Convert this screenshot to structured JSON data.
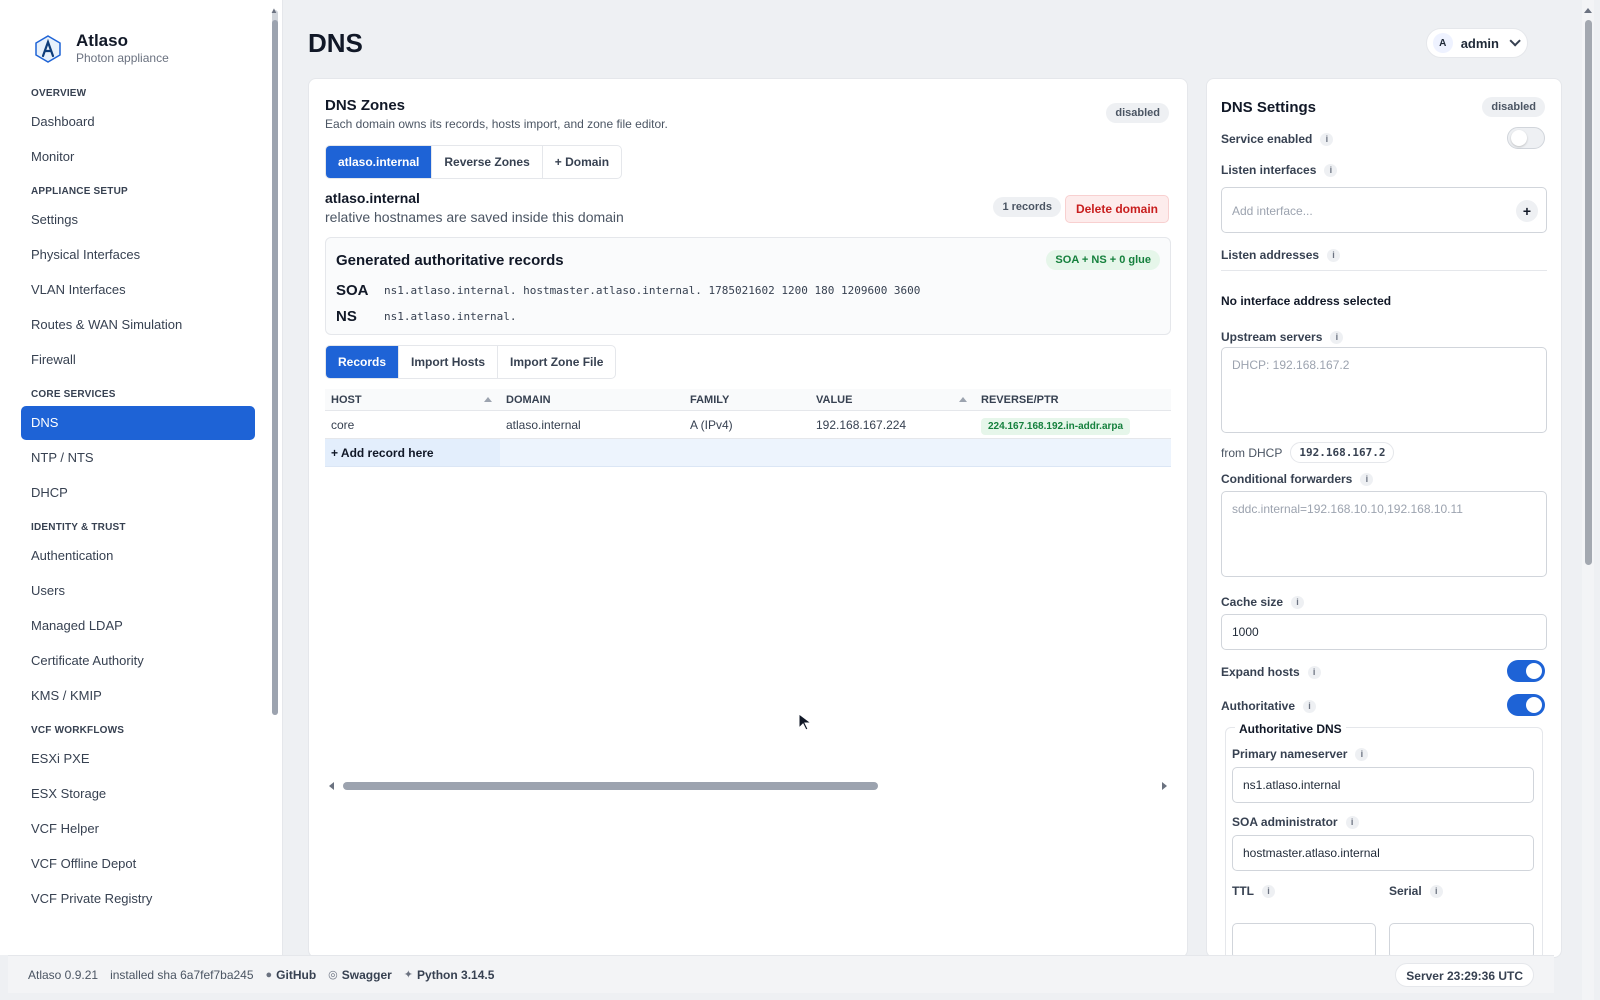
{
  "brand": {
    "name": "Atlaso",
    "subtitle": "Photon appliance"
  },
  "nav": {
    "sections": [
      {
        "title": "OVERVIEW",
        "items": [
          "Dashboard",
          "Monitor"
        ]
      },
      {
        "title": "APPLIANCE SETUP",
        "items": [
          "Settings",
          "Physical Interfaces",
          "VLAN Interfaces",
          "Routes & WAN Simulation",
          "Firewall"
        ]
      },
      {
        "title": "CORE SERVICES",
        "items": [
          "DNS",
          "NTP / NTS",
          "DHCP"
        ]
      },
      {
        "title": "IDENTITY & TRUST",
        "items": [
          "Authentication",
          "Users",
          "Managed LDAP",
          "Certificate Authority",
          "KMS / KMIP"
        ]
      },
      {
        "title": "VCF WORKFLOWS",
        "items": [
          "ESXi PXE",
          "ESX Storage",
          "VCF Helper",
          "VCF Offline Depot",
          "VCF Private Registry"
        ]
      }
    ],
    "active": "DNS"
  },
  "header": {
    "title": "DNS",
    "user_initial": "A",
    "user_name": "admin"
  },
  "zones": {
    "title": "DNS Zones",
    "subtitle": "Each domain owns its records, hosts import, and zone file editor.",
    "status": "disabled",
    "domain_tabs": [
      "atlaso.internal",
      "Reverse Zones",
      "+ Domain"
    ],
    "domain_name": "atlaso.internal",
    "domain_note": "relative hostnames are saved inside this domain",
    "records_count": "1 records",
    "delete_label": "Delete domain",
    "authoritative": {
      "title": "Generated authoritative records",
      "badge": "SOA + NS + 0 glue",
      "soa_label": "SOA",
      "soa_value": "ns1.atlaso.internal. hostmaster.atlaso.internal. 1785021602 1200 180 1209600 3600",
      "ns_label": "NS",
      "ns_value": "ns1.atlaso.internal."
    },
    "record_tabs": [
      "Records",
      "Import Hosts",
      "Import Zone File"
    ],
    "table": {
      "headers": [
        "HOST",
        "DOMAIN",
        "FAMILY",
        "VALUE",
        "REVERSE/PTR"
      ],
      "rows": [
        {
          "host": "core",
          "domain": "atlaso.internal",
          "family": "A (IPv4)",
          "value": "192.168.167.224",
          "ptr": "224.167.168.192.in-addr.arpa"
        }
      ],
      "add_label": "+ Add record here"
    }
  },
  "settings": {
    "title": "DNS Settings",
    "status": "disabled",
    "service_enabled_label": "Service enabled",
    "service_enabled": false,
    "listen_interfaces_label": "Listen interfaces",
    "listen_interfaces_placeholder": "Add interface...",
    "listen_addresses_label": "Listen addresses",
    "no_address": "No interface address selected",
    "upstream_label": "Upstream servers",
    "upstream_placeholder": "DHCP: 192.168.167.2",
    "from_dhcp_label": "from DHCP",
    "from_dhcp_value": "192.168.167.2",
    "cond_fwd_label": "Conditional forwarders",
    "cond_fwd_placeholder": "sddc.internal=192.168.10.10,192.168.10.11",
    "cache_label": "Cache size",
    "cache_value": "1000",
    "expand_hosts_label": "Expand hosts",
    "expand_hosts": true,
    "authoritative_label": "Authoritative",
    "authoritative": true,
    "auth_dns": {
      "legend": "Authoritative DNS",
      "primary_ns_label": "Primary nameserver",
      "primary_ns_value": "ns1.atlaso.internal",
      "soa_admin_label": "SOA administrator",
      "soa_admin_value": "hostmaster.atlaso.internal",
      "ttl_label": "TTL",
      "serial_label": "Serial"
    },
    "info_glyph": "i"
  },
  "footer": {
    "version": "Atlaso 0.9.21",
    "sha": "installed sha 6a7fef7ba245",
    "github": "GitHub",
    "swagger": "Swagger",
    "python": "Python 3.14.5",
    "server_time": "Server 23:29:36 UTC"
  },
  "colors": {
    "accent": "#1e63d6",
    "danger": "#c81e1e",
    "success": "#15803d"
  }
}
